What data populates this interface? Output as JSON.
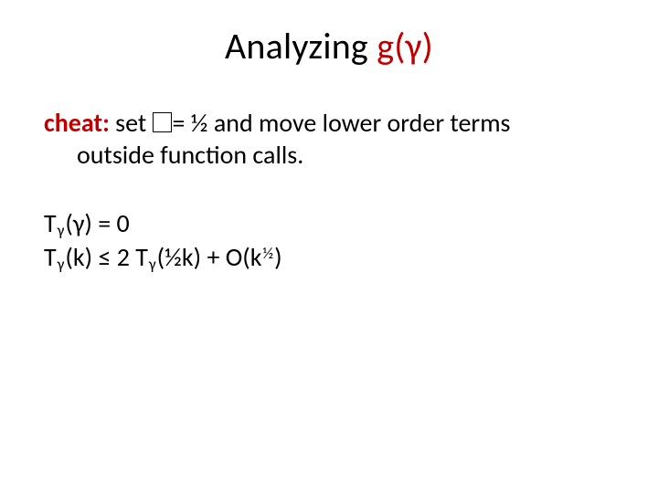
{
  "title": {
    "main": "Analyzing ",
    "accent": "g(γ)"
  },
  "body": {
    "para1": {
      "cheat": "cheat:",
      "set_word": " set ",
      "eq_half_and_rest": "= ½ and move lower order terms",
      "line2": "outside function calls."
    },
    "eq": {
      "row1": {
        "T": "T",
        "sub1": "γ",
        "after1": "(γ) = 0"
      },
      "row2": {
        "T": "T",
        "sub1": "γ",
        "mid1": "(k)  ≤ 2 T",
        "sub2": "γ",
        "mid2": "(½k) + O(k",
        "sup": "½",
        "tail": ")"
      }
    }
  }
}
